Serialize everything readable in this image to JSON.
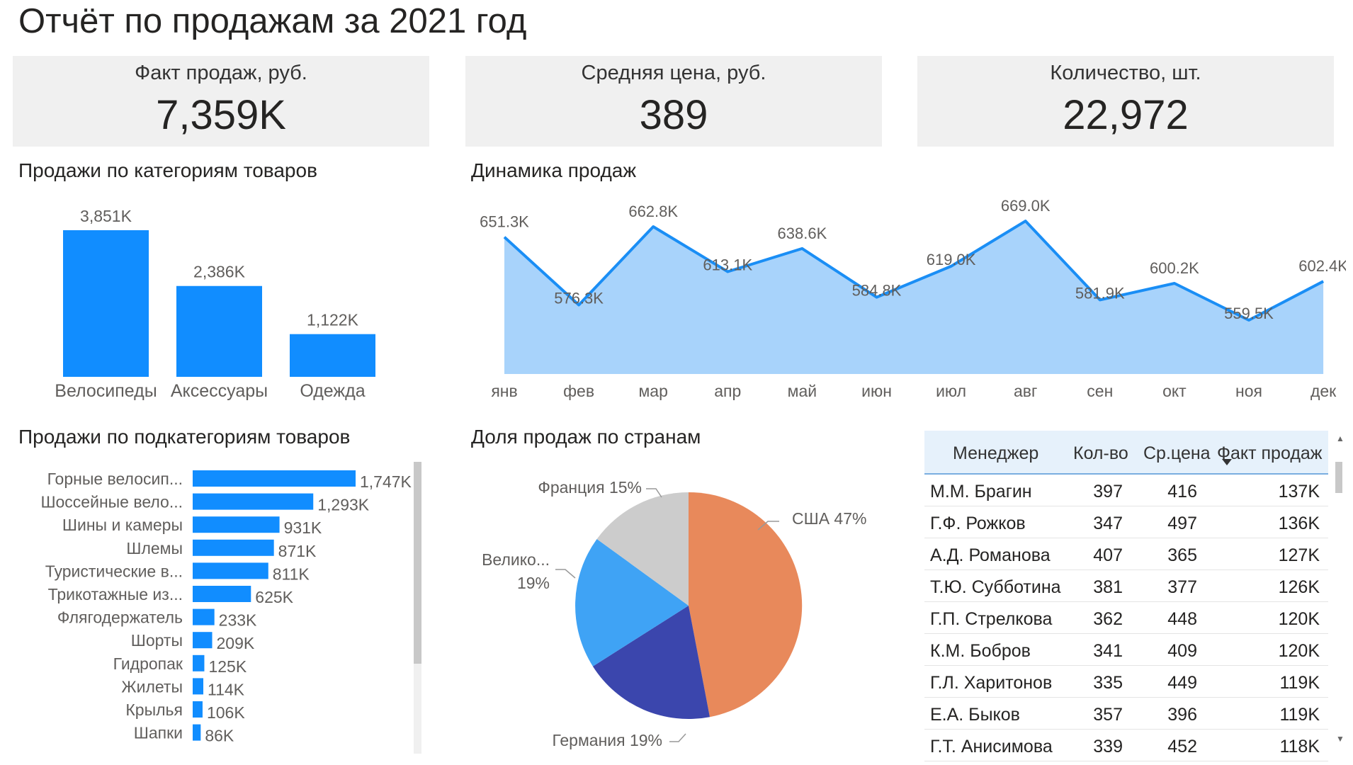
{
  "title": "Отчёт по продажам за 2021 год",
  "kpis": [
    {
      "label": "Факт продаж, руб.",
      "value": "7,359K"
    },
    {
      "label": "Средняя цена, руб.",
      "value": "389"
    },
    {
      "label": "Количество, шт.",
      "value": "22,972"
    }
  ],
  "sections": {
    "categories": "Продажи по категориям товаров",
    "dynamics": "Динамика продаж",
    "subcategories": "Продажи по подкатегориям товаров",
    "countries": "Доля продаж по странам"
  },
  "colors": {
    "bar": "#118dff",
    "area_line": "#1a8ef5",
    "area_fill": "#a8d3fb",
    "pie": [
      "#e8895b",
      "#3b46ad",
      "#3fa3f5",
      "#cccccc"
    ]
  },
  "chart_data": [
    {
      "type": "bar",
      "title": "Продажи по категориям товаров",
      "categories": [
        "Велосипеды",
        "Аксессуары",
        "Одежда"
      ],
      "values": [
        3851,
        2386,
        1122
      ],
      "labels": [
        "3,851K",
        "2,386K",
        "1,122K"
      ],
      "ylim": [
        0,
        3851
      ]
    },
    {
      "type": "area",
      "title": "Динамика продаж",
      "categories": [
        "янв",
        "фев",
        "мар",
        "апр",
        "май",
        "июн",
        "июл",
        "авг",
        "сен",
        "окт",
        "ноя",
        "дек"
      ],
      "values": [
        651.3,
        576.3,
        662.8,
        613.1,
        638.6,
        584.8,
        619.0,
        669.0,
        581.9,
        600.2,
        559.5,
        602.4
      ],
      "labels": [
        "651.3K",
        "576.3K",
        "662.8K",
        "613.1K",
        "638.6K",
        "584.8K",
        "619.0K",
        "669.0K",
        "581.9K",
        "600.2K",
        "559.5K",
        "602.4K"
      ],
      "ylim": [
        500,
        680
      ]
    },
    {
      "type": "bar",
      "orientation": "horizontal",
      "title": "Продажи по подкатегориям товаров",
      "categories": [
        "Горные велосип...",
        "Шоссейные вело...",
        "Шины и камеры",
        "Шлемы",
        "Туристические в...",
        "Трикотажные из...",
        "Флягодержатель",
        "Шорты",
        "Гидропак",
        "Жилеты",
        "Крылья",
        "Шапки"
      ],
      "values": [
        1747,
        1293,
        931,
        871,
        811,
        625,
        233,
        209,
        125,
        114,
        106,
        86
      ],
      "labels": [
        "1,747K",
        "1,293K",
        "931K",
        "871K",
        "811K",
        "625K",
        "233K",
        "209K",
        "125K",
        "114K",
        "106K",
        "86K"
      ],
      "ylim": [
        0,
        1747
      ]
    },
    {
      "type": "pie",
      "title": "Доля продаж по странам",
      "slices": [
        {
          "label": "США 47%",
          "value": 47
        },
        {
          "label": "Германия 19%",
          "value": 19
        },
        {
          "label": "Велико... 19%",
          "value": 19
        },
        {
          "label": "Франция 15%",
          "value": 15
        }
      ]
    },
    {
      "type": "table",
      "columns": [
        "Менеджер",
        "Кол-во",
        "Ср.цена",
        "Факт продаж"
      ],
      "rows": [
        [
          "М.М. Брагин",
          "397",
          "416",
          "137K"
        ],
        [
          "Г.Ф. Рожков",
          "347",
          "497",
          "136K"
        ],
        [
          "А.Д. Романова",
          "407",
          "365",
          "127K"
        ],
        [
          "Т.Ю. Субботина",
          "381",
          "377",
          "126K"
        ],
        [
          "Г.П. Стрелкова",
          "362",
          "448",
          "120K"
        ],
        [
          "К.М. Бобров",
          "341",
          "409",
          "120K"
        ],
        [
          "Г.Л. Харитонов",
          "335",
          "449",
          "119K"
        ],
        [
          "Е.А. Быков",
          "357",
          "396",
          "119K"
        ],
        [
          "Г.Т. Анисимова",
          "339",
          "452",
          "118K"
        ]
      ]
    }
  ]
}
